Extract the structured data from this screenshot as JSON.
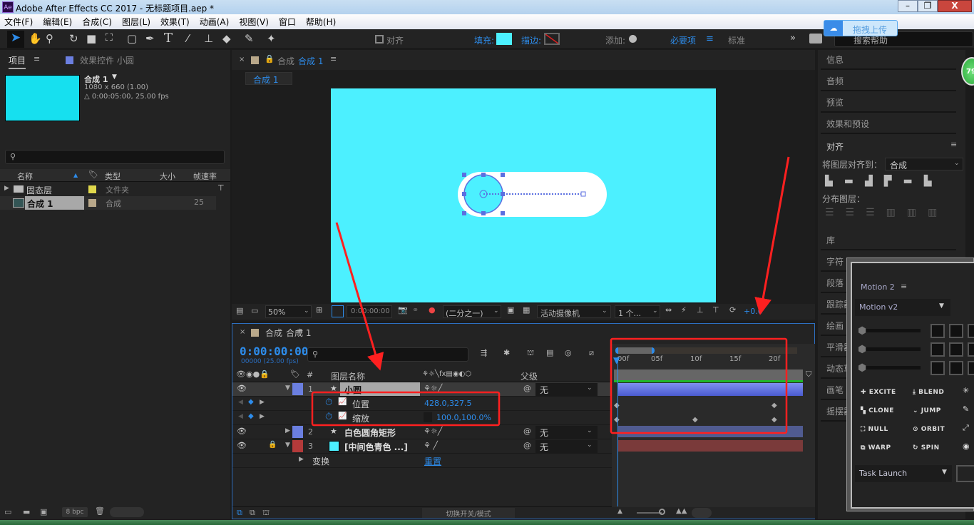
{
  "window": {
    "title": "Adobe After Effects CC 2017 - 无标题项目.aep *",
    "app_icon": "Ae"
  },
  "menu": [
    "文件(F)",
    "编辑(E)",
    "合成(C)",
    "图层(L)",
    "效果(T)",
    "动画(A)",
    "视图(V)",
    "窗口",
    "帮助(H)"
  ],
  "toolbar": {
    "align_label": "对齐",
    "fill_label": "填充:",
    "stroke_label": "描边:",
    "add_label": "添加:",
    "workspace_active": "必要项",
    "workspace_other": "标准",
    "search_placeholder": "搜索帮助",
    "fill_color": "#4cf0ff"
  },
  "upload_badge": {
    "label": "拖拽上传"
  },
  "green_badge": "79",
  "project": {
    "tab": "项目",
    "effects_tab": "效果控件 小圆",
    "comp_name": "合成 1",
    "comp_dims": "1080 x 660 (1.00)",
    "comp_duration": "△ 0:00:05:00, 25.00 fps",
    "thumb_color": "#16e0ef",
    "columns": [
      "名称",
      "类型",
      "大小",
      "帧速率"
    ],
    "items": [
      {
        "name": "固态层",
        "type": "文件夹",
        "fps": "",
        "color": "#e0d84c"
      },
      {
        "name": "合成 1",
        "type": "合成",
        "fps": "25",
        "color": "#b9a88a"
      }
    ],
    "bpc": "8 bpc"
  },
  "composition": {
    "tab_title": "合成",
    "tab_name": "合成 1",
    "sub_tab": "合成 1",
    "canvas_color": "#4cf0ff",
    "zoom": "50%",
    "timecode": "0:00:00:00",
    "resolution": "(二分之一)",
    "camera": "活动摄像机",
    "views": "1 个...",
    "exposure": "+0.0"
  },
  "timeline": {
    "tab_title": "合成",
    "tab_name": "合成 1",
    "timecode": "0:00:00:00",
    "frame_info": "00000 (25.00 fps)",
    "headers": {
      "name": "图层名称",
      "num": "#",
      "parent": "父级"
    },
    "layers": [
      {
        "num": "1",
        "name": "小圆",
        "color": "#6b7fe0",
        "parent": "无"
      },
      {
        "num": "2",
        "name": "白色圆角矩形",
        "color": "#6b7fe0",
        "parent": "无"
      },
      {
        "num": "3",
        "name": "[中间色青色 ...]",
        "color": "#b33a3a",
        "parent": "无"
      }
    ],
    "properties": [
      {
        "name": "位置",
        "value": "428.0,327.5"
      },
      {
        "name": "缩放",
        "value": "100.0,100.0%"
      }
    ],
    "transform": {
      "name": "变换",
      "reset": "重置"
    },
    "ruler": [
      "00f",
      "05f",
      "10f",
      "15f",
      "20f"
    ],
    "footer": "切换开关/模式"
  },
  "right_panel": {
    "items": [
      "信息",
      "音频",
      "预览",
      "效果和预设"
    ],
    "align": {
      "title": "对齐",
      "align_to_label": "将图层对齐到：",
      "align_to_value": "合成",
      "distribute_label": "分布图层："
    },
    "items2": [
      "库",
      "字符",
      "段落",
      "跟踪器",
      "绘画",
      "平滑器",
      "动态草图",
      "画笔",
      "摇摆器"
    ]
  },
  "motion2": {
    "title": "Motion 2",
    "preset": "Motion v2",
    "buttons": [
      "EXCITE",
      "BLEND",
      "CLONE",
      "JUMP",
      "NULL",
      "ORBIT",
      "WARP",
      "SPIN"
    ],
    "task": "Task Launch"
  }
}
